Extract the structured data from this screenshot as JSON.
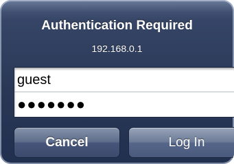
{
  "dialog": {
    "title": "Authentication Required",
    "host": "192.168.0.1"
  },
  "fields": {
    "username_value": "guest",
    "password_masked": "●●●●●●●"
  },
  "buttons": {
    "cancel_label": "Cancel",
    "login_label": "Log In"
  }
}
